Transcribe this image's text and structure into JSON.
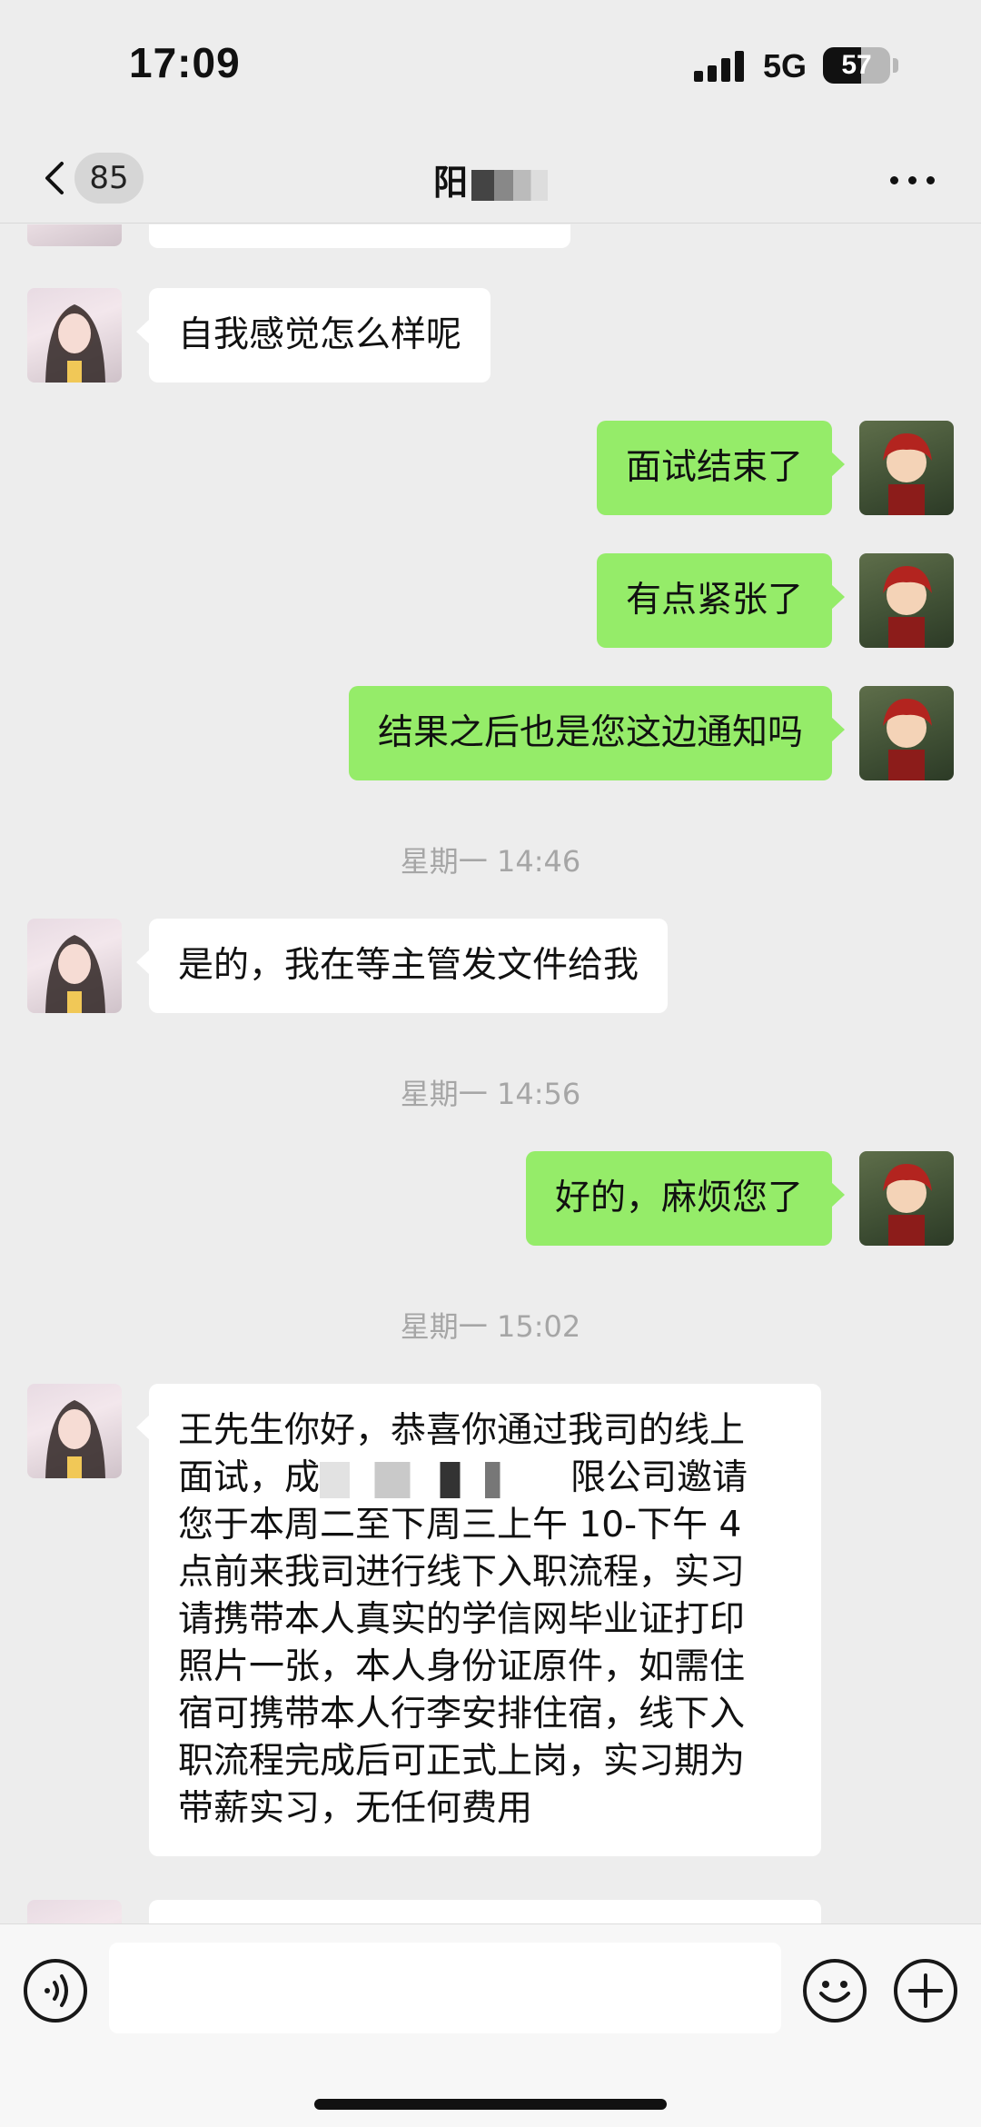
{
  "status_bar": {
    "time": "17:09",
    "network": "5G",
    "battery": "57"
  },
  "nav": {
    "unread_count": "85",
    "title": "阳"
  },
  "messages": [
    {
      "side": "left",
      "text": "自我感觉怎么样呢"
    },
    {
      "side": "right",
      "text": "面试结束了"
    },
    {
      "side": "right",
      "text": "有点紧张了"
    },
    {
      "side": "right",
      "text": "结果之后也是您这边通知吗"
    },
    {
      "side": "left",
      "text": "是的，我在等主管发文件给我"
    },
    {
      "side": "right",
      "text": "好的，麻烦您了"
    },
    {
      "side": "left",
      "lines": [
        "王先生你好，恭喜你通过我司的线上",
        "面试，成",
        "限公司邀请",
        "您于本周二至下周三上午 10-下午 4",
        "点前来我司进行线下入职流程，实习",
        "请携带本人真实的学信网毕业证打印",
        "照片一张，本人身份证原件，如需住",
        "宿可携带本人行李安排住宿，线下入",
        "职流程完成后可正式上岗，实习期为",
        "带薪实习，无任何费用"
      ]
    }
  ],
  "timestamps": [
    "星期一 14:46",
    "星期一 14:56",
    "星期一 15:02"
  ],
  "icons": {
    "back": "chevron-left-icon",
    "more": "more-dots-icon",
    "voice": "voice-icon",
    "emoji": "emoji-icon",
    "plus": "plus-icon"
  },
  "colors": {
    "sent_bubble": "#95ec69",
    "received_bubble": "#ffffff",
    "background": "#ededed"
  }
}
